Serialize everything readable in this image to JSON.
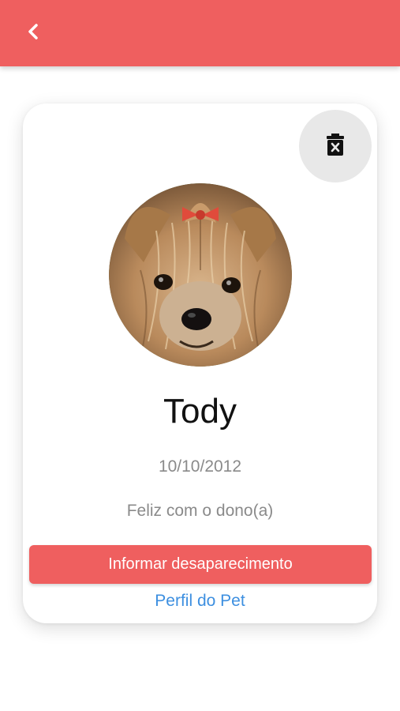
{
  "header": {
    "back_icon": "chevron-left-icon",
    "background_color": "#ef5f5f"
  },
  "card": {
    "delete_icon": "trash-x-icon",
    "pet_photo": "yorkshire-terrier-photo",
    "pet_name": "Tody",
    "pet_birthdate": "10/10/2012",
    "pet_status": "Feliz com o dono(a)",
    "report_missing_label": "Informar desaparecimento",
    "profile_link_label": "Perfil do Pet"
  },
  "colors": {
    "accent": "#ef5f5f",
    "link": "#3d8fe0",
    "muted_text": "#8a8a8a"
  }
}
